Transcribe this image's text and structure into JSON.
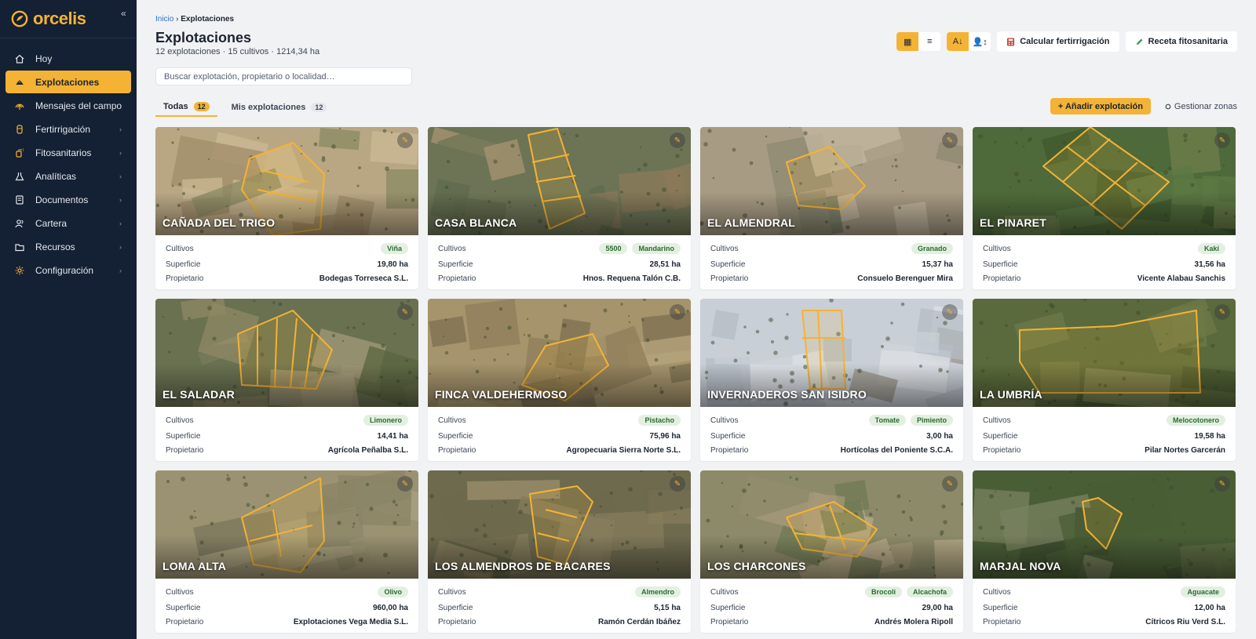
{
  "sidebar": {
    "brand": "orcelis",
    "collapse_icon": "«",
    "items": [
      {
        "label": "Hoy",
        "icon": "home-icon",
        "active": false,
        "has_children": false
      },
      {
        "label": "Explotaciones",
        "icon": "field-icon",
        "active": true,
        "has_children": false
      },
      {
        "label": "Mensajes del campo",
        "icon": "message-icon",
        "active": false,
        "has_children": false
      },
      {
        "label": "Fertirrigación",
        "icon": "drop-icon",
        "active": false,
        "has_children": true
      },
      {
        "label": "Fitosanitarios",
        "icon": "spray-icon",
        "active": false,
        "has_children": true
      },
      {
        "label": "Analíticas",
        "icon": "flask-icon",
        "active": false,
        "has_children": true
      },
      {
        "label": "Documentos",
        "icon": "document-icon",
        "active": false,
        "has_children": true
      },
      {
        "label": "Cartera",
        "icon": "users-icon",
        "active": false,
        "has_children": true
      },
      {
        "label": "Recursos",
        "icon": "folder-icon",
        "active": false,
        "has_children": true
      },
      {
        "label": "Configuración",
        "icon": "gear-icon",
        "active": false,
        "has_children": true
      }
    ]
  },
  "breadcrumb": {
    "home": "Inicio",
    "separator": "›",
    "current": "Explotaciones"
  },
  "page": {
    "title": "Explotaciones",
    "subtitle": "12 explotaciones · 15 cultivos · 1214,34 ha"
  },
  "search": {
    "placeholder": "Buscar explotación, propietario o localidad…",
    "value": ""
  },
  "toolbar": {
    "grid_view": "▦",
    "list_view": "≡",
    "sort_alpha": "A↓",
    "sort_owner": "👤↕",
    "fertirrigation_label": "Calcular fertirrigación",
    "prescription_label": "Receta fitosanitaria"
  },
  "tabs": [
    {
      "label": "Todas",
      "count": "12",
      "active": true
    },
    {
      "label": "Mis explotaciones",
      "count": "12",
      "active": false
    }
  ],
  "actions": {
    "add_label": "+ Añadir explotación",
    "zones_label": "Gestionar zonas"
  },
  "labels": {
    "crops": "Cultivos",
    "surface": "Superficie",
    "owner": "Propietario"
  },
  "colors": {
    "accent": "#f4b335",
    "sidebar": "#142033",
    "chip_bg": "#e3f0e1",
    "chip_text": "#2d6a31"
  },
  "farms": [
    {
      "name": "CAÑADA DEL TRIGO",
      "crops": [
        "Viña"
      ],
      "surface": "19,80 ha",
      "owner": "Bodegas Torreseca S.L."
    },
    {
      "name": "CASA BLANCA",
      "crops": [
        "5500",
        "Mandarino"
      ],
      "surface": "28,51 ha",
      "owner": "Hnos. Requena Talón C.B."
    },
    {
      "name": "EL ALMENDRAL",
      "crops": [
        "Granado"
      ],
      "surface": "15,37 ha",
      "owner": "Consuelo Berenguer Mira"
    },
    {
      "name": "EL PINARET",
      "crops": [
        "Kaki"
      ],
      "surface": "31,56 ha",
      "owner": "Vicente Alabau Sanchis"
    },
    {
      "name": "EL SALADAR",
      "crops": [
        "Limonero"
      ],
      "surface": "14,41 ha",
      "owner": "Agrícola Peñalba S.L."
    },
    {
      "name": "FINCA VALDEHERMOSO",
      "crops": [
        "Pistacho"
      ],
      "surface": "75,96 ha",
      "owner": "Agropecuaria Sierra Norte S.L."
    },
    {
      "name": "INVERNADEROS SAN ISIDRO",
      "crops": [
        "Tomate",
        "Pimiento"
      ],
      "surface": "3,00 ha",
      "owner": "Hortícolas del Poniente S.C.A."
    },
    {
      "name": "LA UMBRÍA",
      "crops": [
        "Melocotonero"
      ],
      "surface": "19,58 ha",
      "owner": "Pilar Nortes Garcerán"
    },
    {
      "name": "LOMA ALTA",
      "crops": [
        "Olivo"
      ],
      "surface": "960,00 ha",
      "owner": "Explotaciones Vega Media S.L."
    },
    {
      "name": "LOS ALMENDROS DE BACARES",
      "crops": [
        "Almendro"
      ],
      "surface": "5,15 ha",
      "owner": "Ramón Cerdán Ibáñez"
    },
    {
      "name": "LOS CHARCONES",
      "crops": [
        "Brocoli",
        "Alcachofa"
      ],
      "surface": "29,00 ha",
      "owner": "Andrés Molera Ripoll"
    },
    {
      "name": "MARJAL NOVA",
      "crops": [
        "Aguacate"
      ],
      "surface": "12,00 ha",
      "owner": "Cítricos Riu Verd S.L."
    }
  ]
}
